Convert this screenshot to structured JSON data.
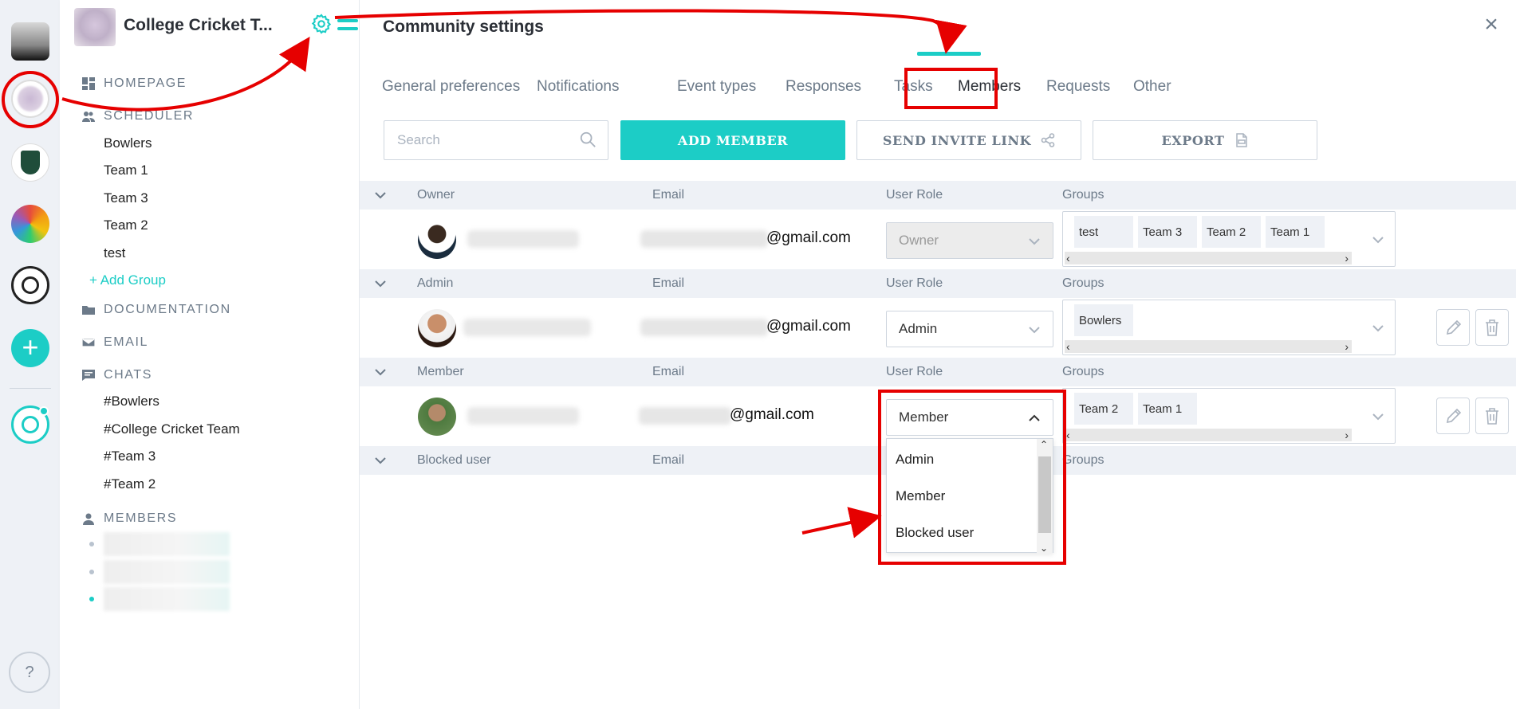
{
  "community": {
    "name": "College Cricket T..."
  },
  "sidebar": {
    "homepage": "HOMEPAGE",
    "scheduler": "SCHEDULER",
    "groups": [
      "Bowlers",
      "Team 1",
      "Team 3",
      "Team 2",
      "test"
    ],
    "add_group": "+ Add Group",
    "documentation": "DOCUMENTATION",
    "email": "EMAIL",
    "chats_label": "CHATS",
    "chats": [
      "#Bowlers",
      "#College Cricket Team",
      "#Team 3",
      "#Team 2"
    ],
    "members_label": "MEMBERS"
  },
  "page": {
    "title": "Community settings",
    "close": "×"
  },
  "tabs": [
    "General preferences",
    "Notifications",
    "Event types",
    "Responses",
    "Tasks",
    "Members",
    "Requests",
    "Other"
  ],
  "toolbar": {
    "search_placeholder": "Search",
    "add_member": "ADD MEMBER",
    "send_invite": "SEND INVITE LINK",
    "export": "EXPORT"
  },
  "columns": {
    "email": "Email",
    "role": "User Role",
    "groups": "Groups"
  },
  "sections": {
    "owner": "Owner",
    "admin": "Admin",
    "member": "Member",
    "blocked": "Blocked user"
  },
  "rows": {
    "owner": {
      "email_suffix": "@gmail.com",
      "role": "Owner",
      "groups": [
        "test",
        "Team 3",
        "Team 2",
        "Team 1"
      ]
    },
    "admin": {
      "email_suffix": "@gmail.com",
      "role": "Admin",
      "groups": [
        "Bowlers"
      ]
    },
    "member": {
      "email_suffix": "@gmail.com",
      "role": "Member",
      "groups": [
        "Team 2",
        "Team 1"
      ]
    }
  },
  "role_options": [
    "Admin",
    "Member",
    "Blocked user"
  ],
  "rail": {
    "help": "?"
  },
  "colors": {
    "accent": "#1ccdc6",
    "annotation": "#e60000"
  }
}
